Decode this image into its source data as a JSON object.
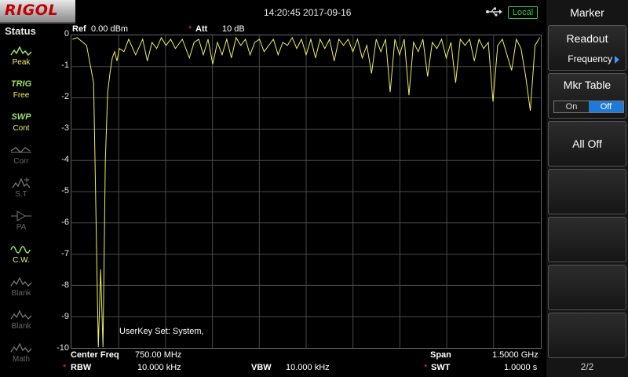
{
  "header": {
    "logo": "RIGOL",
    "datetime": "14:20:45 2017-09-16",
    "usb_icon": "usb-icon",
    "local_label": "Local"
  },
  "status_panel": {
    "title": "Status",
    "items": [
      {
        "icon": "peak-icon",
        "label": "Peak",
        "active": true
      },
      {
        "icon_text": "TRIG",
        "label": "Free",
        "active": true
      },
      {
        "icon_text": "SWP",
        "label": "Cont",
        "active": true
      },
      {
        "icon": "corr-icon",
        "label": "Corr",
        "active": false
      },
      {
        "icon": "st-icon",
        "label": "S.T",
        "active": false
      },
      {
        "icon": "pa-icon",
        "label": "PA",
        "active": false
      },
      {
        "icon": "cw-icon",
        "label": "C.W.",
        "active": true
      },
      {
        "icon": "blank-icon",
        "label": "Blank",
        "active": false
      },
      {
        "icon": "blank-icon",
        "label": "Blank",
        "active": false
      },
      {
        "icon": "math-icon",
        "label": "Math",
        "active": false
      }
    ]
  },
  "graph_header": {
    "ref_label": "Ref",
    "ref_value": "0.00 dBm",
    "att_label": "Att",
    "att_value": "10 dB"
  },
  "y_ticks": [
    "0",
    "-1",
    "-2",
    "-3",
    "-4",
    "-5",
    "-6",
    "-7",
    "-8",
    "-9",
    "-10"
  ],
  "userkey_text": "UserKey Set:    System,",
  "footer": {
    "center_freq_label": "Center Freq",
    "center_freq_value": "750.00 MHz",
    "span_label": "Span",
    "span_value": "1.5000 GHz",
    "rbw_label": "RBW",
    "rbw_value": "10.000 kHz",
    "vbw_label": "VBW",
    "vbw_value": "10.000 kHz",
    "swt_label": "SWT",
    "swt_value": "1.0000 s"
  },
  "softkeys": {
    "title": "Marker",
    "readout_label": "Readout",
    "readout_value": "Frequency",
    "mkr_table_label": "Mkr Table",
    "mkr_table_on": "On",
    "mkr_table_off": "Off",
    "all_off_label": "All Off",
    "page": "2/2"
  },
  "colors": {
    "trace": "#f0f060",
    "grid": "#4a4a4a",
    "logo": "#c00000",
    "active_toggle": "#1e7ad6",
    "local": "#2ecc40"
  },
  "chart_data": {
    "type": "line",
    "ylim": [
      -10,
      0
    ],
    "ylabel": "",
    "xlabel": "",
    "grid": true,
    "series": [
      {
        "x": [
          0,
          0.01,
          0.03,
          0.045,
          0.055,
          0.06,
          0.065,
          0.07,
          0.075,
          0.08,
          0.085,
          0.09,
          0.095,
          0.1,
          0.11,
          0.12,
          0.135,
          0.15,
          0.16,
          0.17,
          0.18,
          0.19,
          0.2,
          0.21,
          0.22,
          0.235,
          0.25,
          0.26,
          0.27,
          0.28,
          0.29,
          0.3,
          0.31,
          0.32,
          0.33,
          0.34,
          0.35,
          0.36,
          0.37,
          0.38,
          0.39,
          0.4,
          0.41,
          0.42,
          0.43,
          0.44,
          0.45,
          0.46,
          0.47,
          0.48,
          0.49,
          0.5,
          0.51,
          0.52,
          0.53,
          0.54,
          0.55,
          0.56,
          0.57,
          0.58,
          0.59,
          0.6,
          0.61,
          0.62,
          0.63,
          0.64,
          0.65,
          0.66,
          0.67,
          0.68,
          0.69,
          0.7,
          0.71,
          0.72,
          0.73,
          0.74,
          0.75,
          0.76,
          0.77,
          0.78,
          0.79,
          0.8,
          0.81,
          0.82,
          0.83,
          0.84,
          0.85,
          0.86,
          0.87,
          0.88,
          0.89,
          0.9,
          0.91,
          0.92,
          0.93,
          0.94,
          0.95,
          0.96,
          0.97,
          0.98,
          0.99,
          1.0
        ],
        "y": [
          -0.1,
          -0.05,
          -0.3,
          -1.5,
          -10,
          -7.5,
          -10,
          -4,
          -1.8,
          -1.2,
          -0.7,
          -0.5,
          -0.8,
          -0.4,
          -0.5,
          -0.1,
          -0.6,
          -0.1,
          -0.8,
          -0.2,
          -0.4,
          -0.05,
          -0.3,
          -0.1,
          -0.4,
          -0.1,
          -0.7,
          -0.2,
          -0.1,
          -0.6,
          -0.1,
          -0.9,
          -0.2,
          -0.6,
          -0.1,
          -0.7,
          -0.05,
          -0.3,
          -0.1,
          -0.6,
          -0.2,
          -0.1,
          -0.5,
          -0.3,
          -0.1,
          -0.6,
          -0.2,
          -0.3,
          -0.05,
          -0.4,
          -0.1,
          -0.6,
          -0.1,
          -0.7,
          -0.1,
          -0.4,
          -0.1,
          -0.8,
          -0.1,
          -0.3,
          -0.1,
          -0.5,
          -0.1,
          -0.7,
          -0.3,
          -1.2,
          -0.1,
          -0.5,
          -0.1,
          -1.8,
          -0.1,
          -0.6,
          -0.1,
          -1.9,
          -0.2,
          -0.5,
          -0.1,
          -1.3,
          -0.2,
          -0.4,
          -0.1,
          -0.7,
          -0.2,
          -1.5,
          -0.1,
          -0.3,
          -0.1,
          -0.8,
          -0.1,
          -0.4,
          -0.2,
          -2.1,
          -0.3,
          -0.1,
          -0.6,
          -1.1,
          -0.1,
          -0.4,
          -1.3,
          -2.4,
          -0.3,
          -0.05
        ]
      }
    ]
  }
}
